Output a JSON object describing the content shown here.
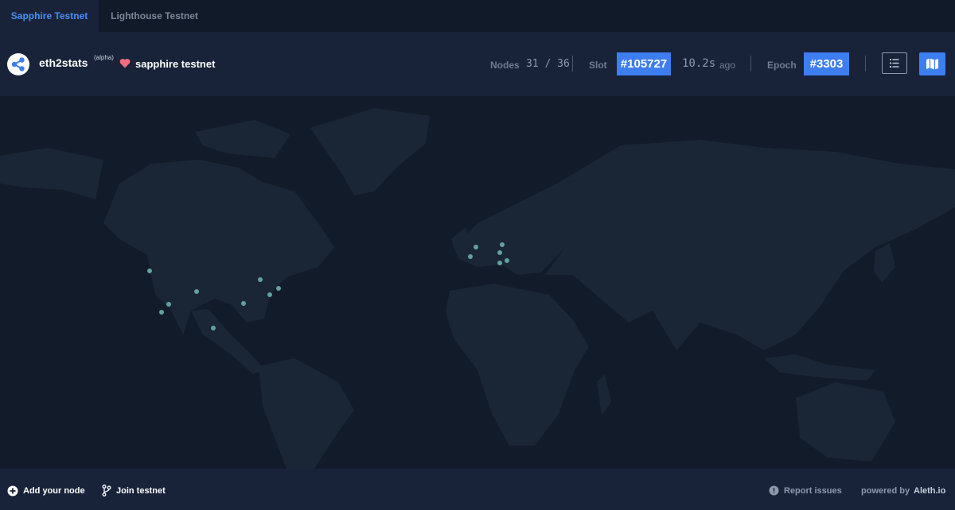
{
  "tabs": [
    {
      "label": "Sapphire Testnet"
    },
    {
      "label": "Lighthouse Testnet"
    }
  ],
  "header": {
    "brand": "eth2stats",
    "alpha": "(alpha)",
    "network": "sapphire testnet",
    "nodes_label": "Nodes",
    "nodes_value": "31 / 36",
    "slot_label": "Slot",
    "slot_value": "#105727",
    "ago_value": "10.2s",
    "ago_label": "ago",
    "epoch_label": "Epoch",
    "epoch_value": "#3303"
  },
  "map": {
    "dot_color": "#5fa39c",
    "land_color": "#1a2536"
  },
  "footer": {
    "add_node": "Add your node",
    "join": "Join testnet",
    "report": "Report issues",
    "powered_label": "powered by",
    "powered_value": "Aleth.io"
  },
  "colors": {
    "accent": "#3d7ef0",
    "heart": "#f26d7d"
  }
}
